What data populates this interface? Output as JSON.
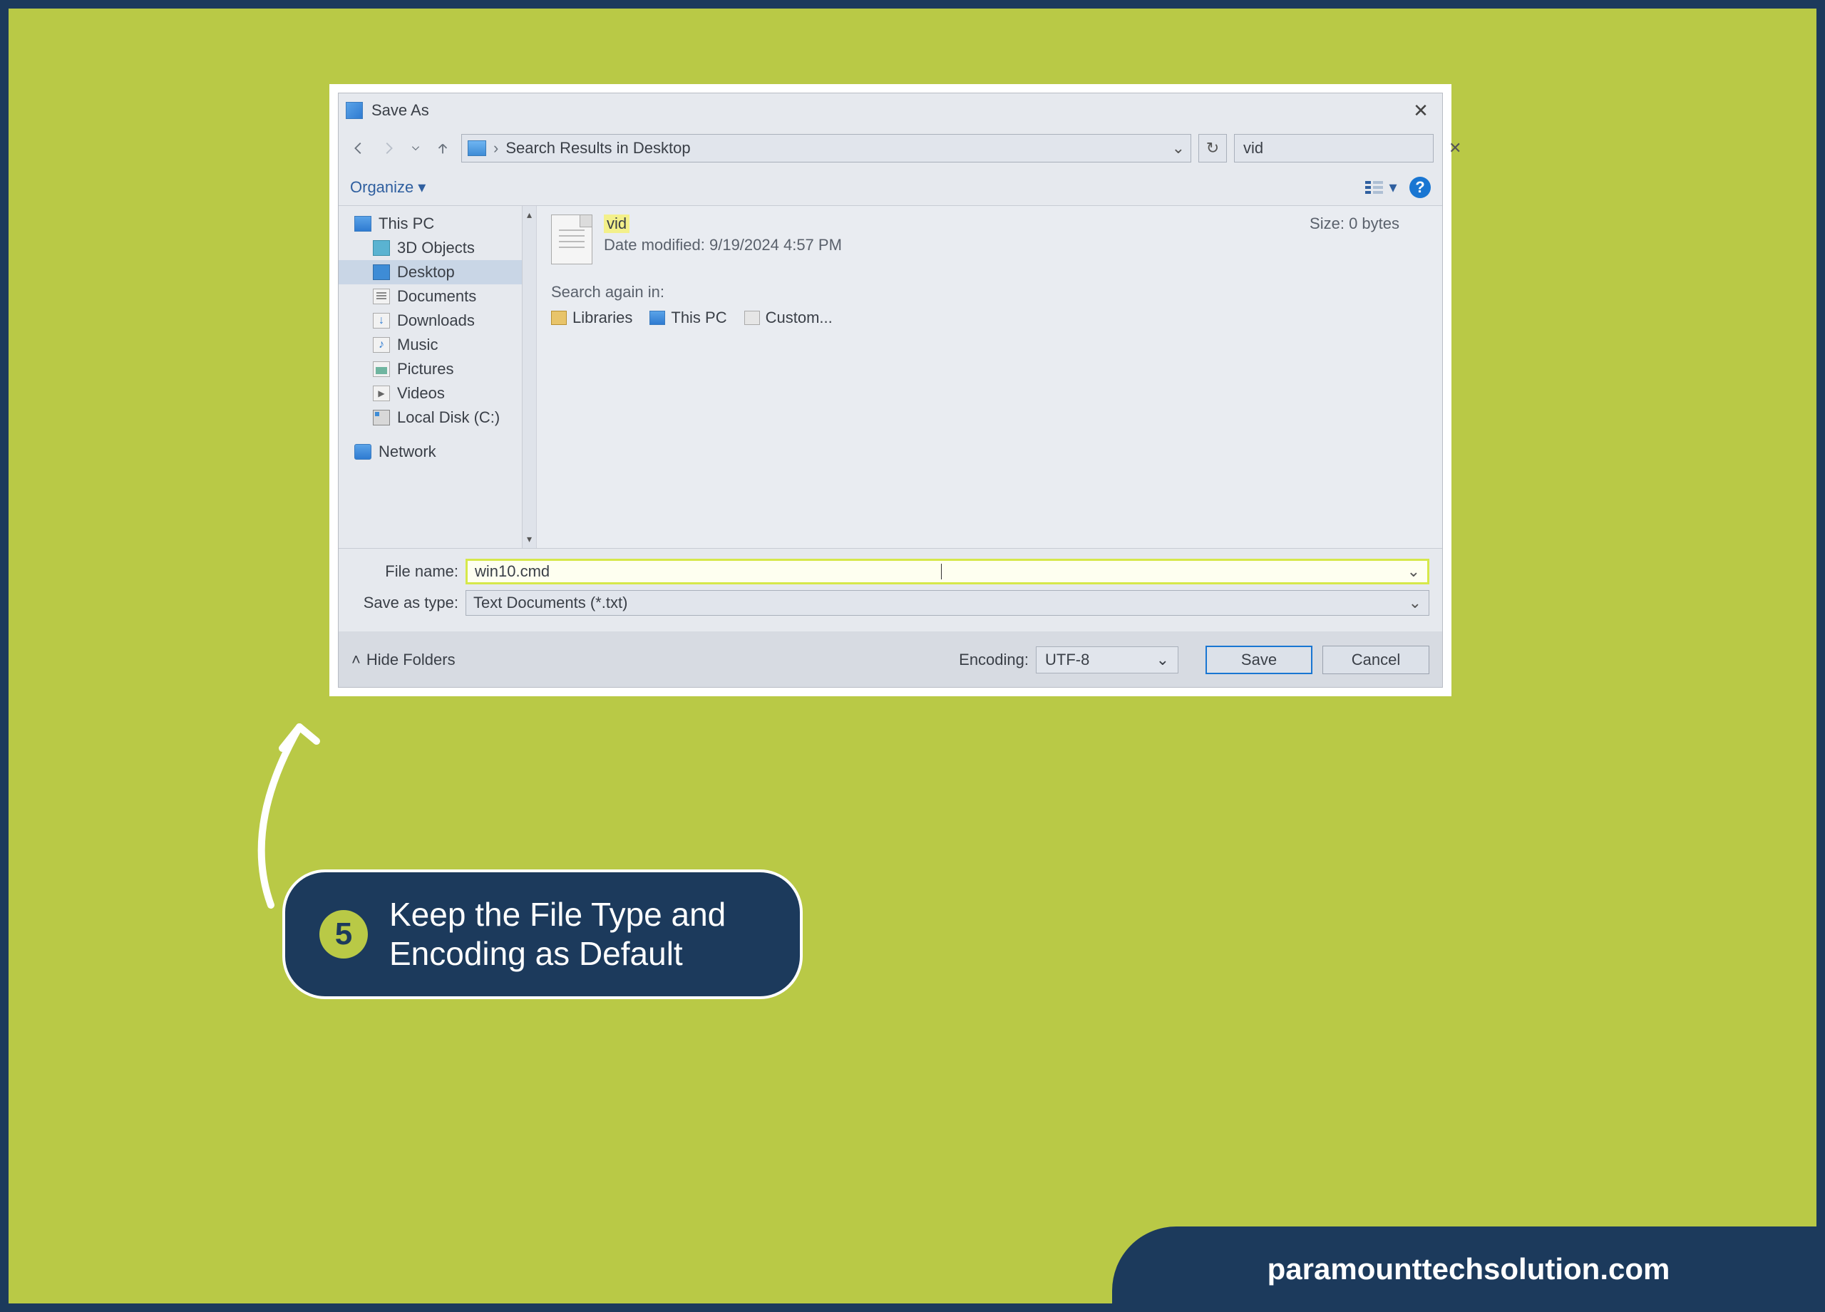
{
  "titlebar": {
    "title": "Save As"
  },
  "nav": {
    "location": "Search Results in Desktop",
    "search_value": "vid"
  },
  "toolbar": {
    "organize": "Organize"
  },
  "tree": {
    "this_pc": "This PC",
    "objects3d": "3D Objects",
    "desktop": "Desktop",
    "documents": "Documents",
    "downloads": "Downloads",
    "music": "Music",
    "pictures": "Pictures",
    "videos": "Videos",
    "local_disk": "Local Disk (C:)",
    "network": "Network"
  },
  "result": {
    "name": "vid",
    "modified_label": "Date modified:",
    "modified": "9/19/2024 4:57 PM",
    "size_label": "Size:",
    "size": "0 bytes"
  },
  "search_again": {
    "label": "Search again in:",
    "libraries": "Libraries",
    "this_pc": "This PC",
    "custom": "Custom..."
  },
  "form": {
    "filename_label": "File name:",
    "filename_value": "win10.cmd",
    "saveastype_label": "Save as type:",
    "saveastype_value": "Text Documents (*.txt)"
  },
  "actions": {
    "hide_folders": "Hide Folders",
    "encoding_label": "Encoding:",
    "encoding_value": "UTF-8",
    "save": "Save",
    "cancel": "Cancel"
  },
  "caption": {
    "step": "5",
    "text": "Keep the File Type and Encoding as Default"
  },
  "footer": {
    "url": "paramounttechsolution.com"
  }
}
